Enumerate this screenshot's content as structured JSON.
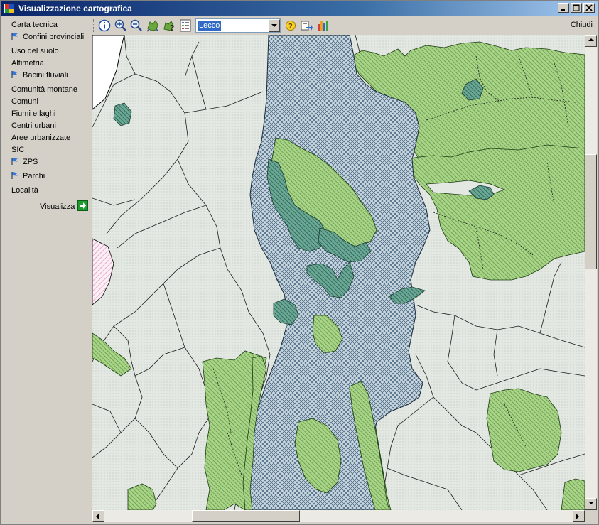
{
  "window": {
    "title": "Visualizzazione cartografica"
  },
  "sidebar": {
    "layers": [
      {
        "label": "Carta tecnica",
        "flag": false
      },
      {
        "label": "Confini provinciali",
        "flag": true
      },
      {
        "label": "Uso del suolo",
        "flag": false
      },
      {
        "label": "Altimetria",
        "flag": false
      },
      {
        "label": "Bacini fluviali",
        "flag": true
      },
      {
        "label": "Comunità montane",
        "flag": false
      },
      {
        "label": "Comuni",
        "flag": false
      },
      {
        "label": "Fiumi e laghi",
        "flag": false
      },
      {
        "label": "Centri urbani",
        "flag": false
      },
      {
        "label": "Aree urbanizzate",
        "flag": false
      },
      {
        "label": "SIC",
        "flag": false
      },
      {
        "label": "ZPS",
        "flag": true
      },
      {
        "label": "Parchi",
        "flag": true
      },
      {
        "label": "Località",
        "flag": false
      }
    ],
    "visualizza_label": "Visualizza"
  },
  "toolbar": {
    "province_value": "Lecco",
    "close_label": "Chiudi"
  },
  "colors": {
    "titlebar": "#0a246a",
    "park_green": "#9fcf7e",
    "province_hatch": "#2f4f6f",
    "zps_teal": "#5aa08a",
    "base_land": "#e3e8e3"
  }
}
